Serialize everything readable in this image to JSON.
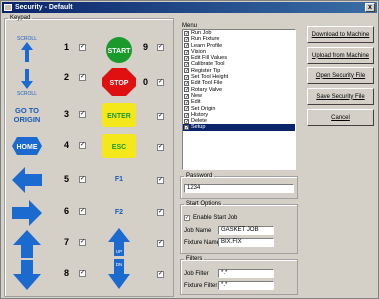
{
  "window": {
    "title": "Security - Default",
    "close": "x"
  },
  "keypad": {
    "legend": "Keypad",
    "left_buttons": [
      {
        "label_top": "SCROLL",
        "label_bottom": "",
        "num": "1",
        "icon": "arrow-up-icon"
      },
      {
        "label_top": "",
        "label_bottom": "SCROLL",
        "num": "2",
        "icon": "arrow-down-icon"
      },
      {
        "label_top": "GO TO",
        "label_bottom": "ORIGIN",
        "num": "3",
        "icon": "go-to-origin-icon"
      },
      {
        "label_top": "HOME",
        "label_bottom": "",
        "num": "4",
        "icon": "home-icon"
      },
      {
        "label_top": "",
        "label_bottom": "",
        "num": "5",
        "icon": "arrow-left-icon"
      },
      {
        "label_top": "",
        "label_bottom": "",
        "num": "6",
        "icon": "arrow-right-icon"
      },
      {
        "label_top": "",
        "label_bottom": "",
        "num": "7",
        "icon": "arrow-up-big-icon"
      },
      {
        "label_top": "",
        "label_bottom": "",
        "num": "8",
        "icon": "arrow-down-big-icon"
      }
    ],
    "right_buttons": [
      {
        "label": "START",
        "num": "9"
      },
      {
        "label": "STOP",
        "num": "0"
      },
      {
        "label": "ENTER",
        "num": ""
      },
      {
        "label": "ESC",
        "num": ""
      },
      {
        "label": "F1",
        "num": ""
      },
      {
        "label": "F2",
        "num": ""
      },
      {
        "label_top": "UP",
        "num": ""
      },
      {
        "label_top": "DN",
        "num": ""
      }
    ],
    "check": "✓"
  },
  "menu": {
    "label": "Menu",
    "items": [
      "Run Job",
      "Run Fixture",
      "Learn Profile",
      "Vision",
      "Edit Fill Values",
      "Calibrate Tool",
      "Register Tip",
      "Set Tool Height",
      "Edit Tool File",
      "Rotary Valve",
      "New",
      "Edit",
      "Set Origin",
      "History",
      "Delete",
      "Setup"
    ],
    "selected": "Setup"
  },
  "actions": {
    "download": "Download to Machine",
    "upload": "Upload from Machine",
    "open": "Open Security File",
    "save": "Save Security File",
    "cancel": "Cancel"
  },
  "password": {
    "legend": "Password",
    "value": "1234"
  },
  "start_options": {
    "legend": "Start Options",
    "enable_label": "Enable Start Job",
    "job_name_label": "Job Name",
    "job_name_value": "GASKET JOB",
    "fixture_name_label": "Fixture Name",
    "fixture_name_value": "BIX.FIX"
  },
  "filters": {
    "legend": "Filters",
    "job_filter_label": "Job Filter",
    "job_filter_value": "*.*",
    "fixture_filter_label": "Fixture Filter",
    "fixture_filter_value": "*.*"
  }
}
